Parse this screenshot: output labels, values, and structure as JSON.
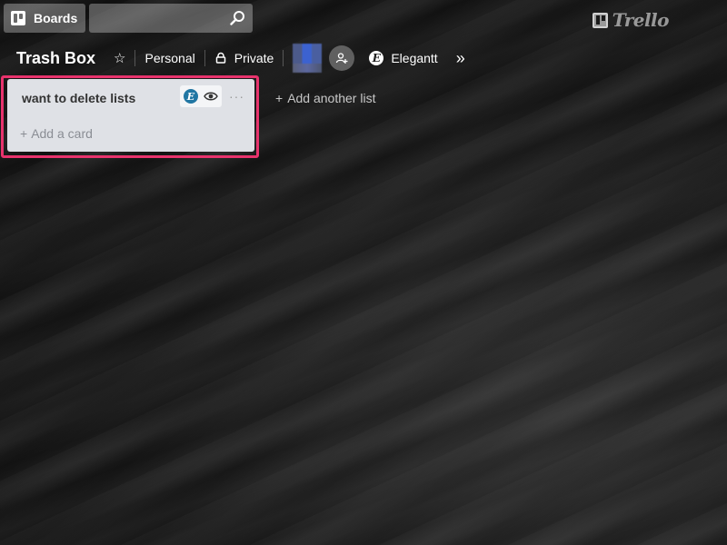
{
  "header": {
    "boards_label": "Boards",
    "search": {
      "value": "",
      "placeholder": ""
    },
    "logo_text": "Trello"
  },
  "board": {
    "title": "Trash Box",
    "team_label": "Personal",
    "visibility_label": "Private",
    "powerup_label": "Elegantt",
    "powerup_badge": "E"
  },
  "lists": [
    {
      "title": "want to delete lists",
      "badge": "E",
      "menu_label": "···",
      "add_card_plus": "+",
      "add_card_label": "Add a card"
    }
  ],
  "add_list": {
    "plus": "+",
    "label": "Add another list"
  },
  "colors": {
    "highlight": "#e8336d",
    "list_bg": "#dfe1e6",
    "elegantt_badge": "#2176a3"
  },
  "icons": {
    "boards": "boards-icon",
    "search": "search-icon",
    "star": "☆",
    "lock": "lock-icon",
    "add_member": "add-member-icon",
    "more": "»",
    "eye": "eye-icon"
  }
}
